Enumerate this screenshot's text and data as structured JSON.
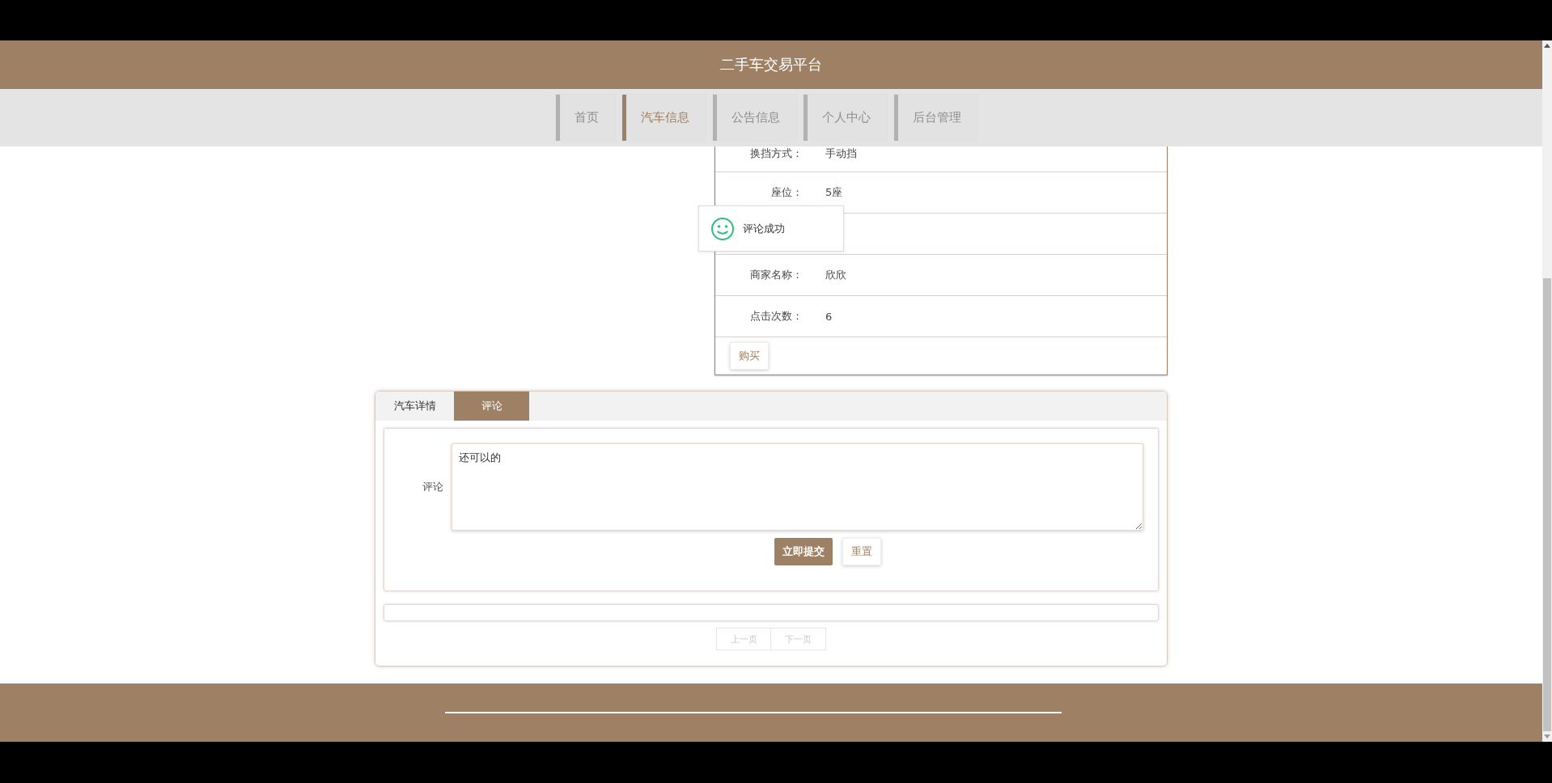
{
  "header": {
    "title": "二手车交易平台"
  },
  "nav": [
    {
      "label": "首页",
      "selected": false
    },
    {
      "label": "汽车信息",
      "selected": true
    },
    {
      "label": "公告信息",
      "selected": false
    },
    {
      "label": "个人中心",
      "selected": false
    },
    {
      "label": "后台管理",
      "selected": false
    }
  ],
  "details": [
    {
      "label": "换挡方式：",
      "value": "手动挡"
    },
    {
      "label": "座位：",
      "value": "5座"
    },
    {
      "hidden": true
    },
    {
      "label": "商家名称：",
      "value": "欣欣"
    },
    {
      "label": "点击次数：",
      "value": "6"
    }
  ],
  "buy_button": "购买",
  "toast": {
    "message": "评论成功"
  },
  "tabs": [
    {
      "label": "汽车详情",
      "selected": false
    },
    {
      "label": "评论",
      "selected": true
    }
  ],
  "comment_form": {
    "label": "评论",
    "value": "还可以的",
    "submit": "立即提交",
    "reset": "重置"
  },
  "pagination": {
    "prev": "上一页",
    "next": "下一页"
  }
}
